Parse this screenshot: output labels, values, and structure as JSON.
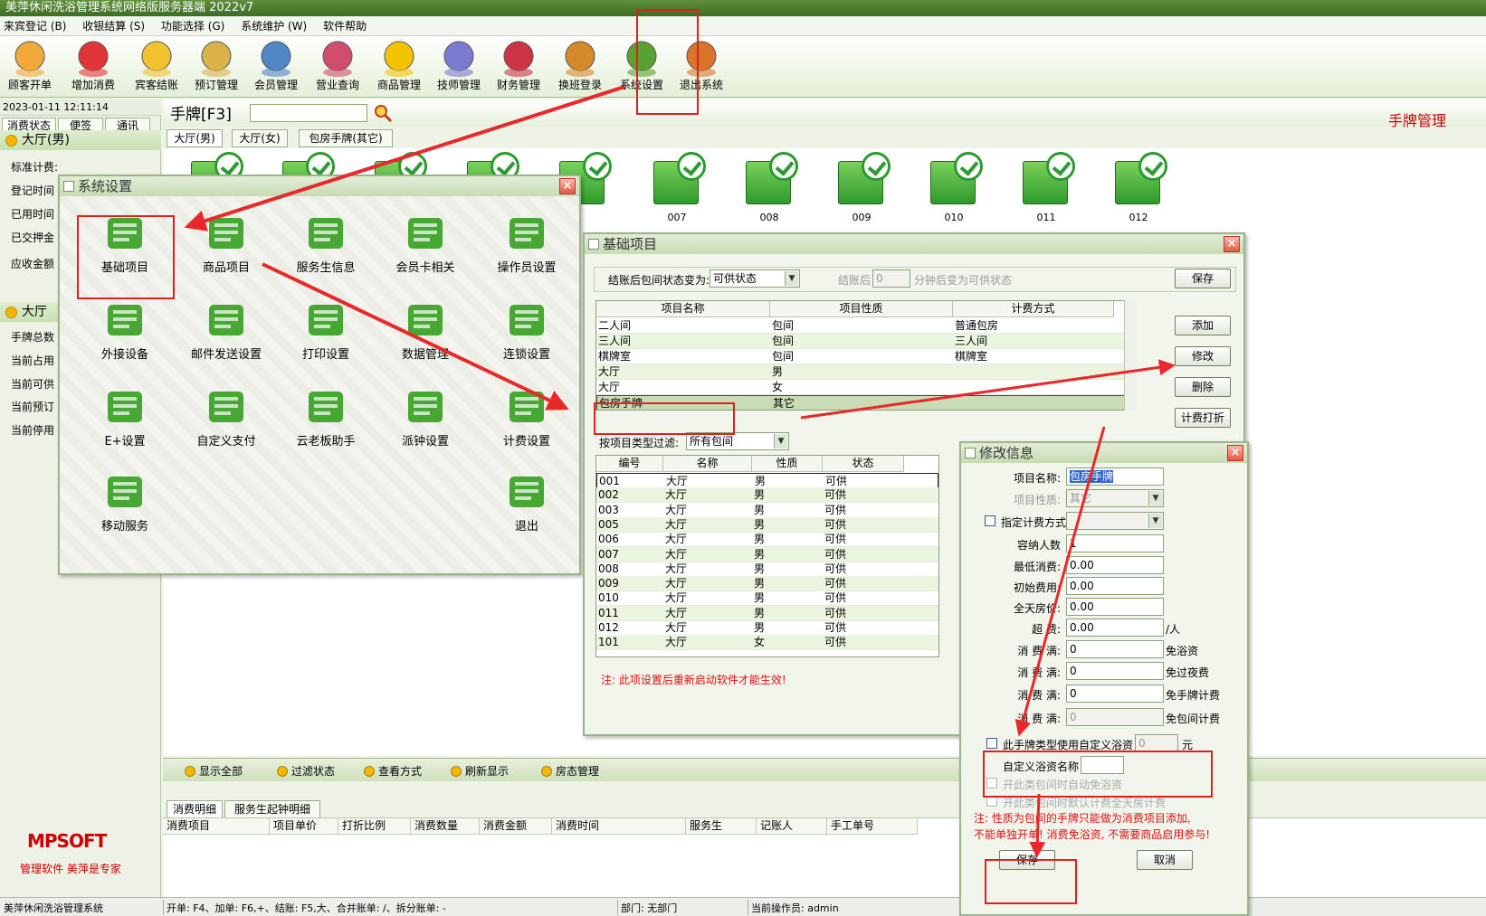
{
  "app": {
    "title": "美萍休闲洗浴管理系统网络版服务器端  2022v7"
  },
  "menu": [
    "来宾登记 (B)",
    "收银结算 (S)",
    "功能选择 (G)",
    "系统维护 (W)",
    "软件帮助"
  ],
  "toolbar": [
    {
      "label": "顾客开单",
      "icon": "customer-icon",
      "color": "#f2a93b"
    },
    {
      "label": "增加消费",
      "icon": "add-consume-icon",
      "color": "#e2353a"
    },
    {
      "label": "宾客结账",
      "icon": "checkout-icon",
      "color": "#f2c230"
    },
    {
      "label": "预订管理",
      "icon": "clock-icon",
      "color": "#d9b24a"
    },
    {
      "label": "会员管理",
      "icon": "members-icon",
      "color": "#4f86c6"
    },
    {
      "label": "营业查询",
      "icon": "query-icon",
      "color": "#d14d6e"
    },
    {
      "label": "商品管理",
      "icon": "star-icon",
      "color": "#f5c400"
    },
    {
      "label": "技师管理",
      "icon": "staff-icon",
      "color": "#7a7ad1"
    },
    {
      "label": "财务管理",
      "icon": "finance-icon",
      "color": "#cc3344"
    },
    {
      "label": "换班登录",
      "icon": "shift-icon",
      "color": "#d48a2a"
    },
    {
      "label": "系统设置",
      "icon": "gear-icon",
      "color": "#5aa032"
    },
    {
      "label": "退出系统",
      "icon": "exit-door-icon",
      "color": "#d9742a"
    }
  ],
  "left": {
    "datetime": "2023-01-11  12:11:14",
    "tabs": [
      "消费状态",
      "便签",
      "通讯"
    ],
    "section1": "大厅(男)",
    "rows1": [
      "标准计费:",
      "登记时间",
      "已用时间",
      "已交押金",
      "应收金额"
    ],
    "section2": "大厅",
    "rows2": [
      "手牌总数",
      "当前占用",
      "当前可供",
      "当前预订",
      "当前停用"
    ],
    "logo": "MPSOFT",
    "slogan": "管理软件   美萍是专家"
  },
  "main": {
    "title": "手牌[F3]",
    "right_title": "手牌管理",
    "tabs": [
      "大厅(男)",
      "大厅(女)",
      "包房手牌(其它)"
    ],
    "cards": [
      "",
      "",
      "",
      "",
      "",
      "007",
      "008",
      "009",
      "010",
      "011",
      "012"
    ]
  },
  "bottom": {
    "items": [
      "显示全部",
      "过滤状态",
      "查看方式",
      "刷新显示",
      "房态管理"
    ],
    "subtabs": [
      "消费明细",
      "服务生起钟明细"
    ],
    "columns": [
      "消费项目",
      "项目单价",
      "打折比例",
      "消费数量",
      "消费金额",
      "消费时间",
      "服务生",
      "记账人",
      "手工单号"
    ]
  },
  "statusbar": {
    "app": "美萍休闲洗浴管理系统",
    "keys": "开单: F4、加单: F6,+、结账: F5,大、合并账单: /、拆分账单: -",
    "dept": "部门: 无部门",
    "operator": "当前操作员: admin"
  },
  "sysset": {
    "title": "系统设置",
    "icons": [
      {
        "label": "基础项目",
        "icon": "star-icon"
      },
      {
        "label": "商品项目",
        "icon": "list-icon"
      },
      {
        "label": "服务生信息",
        "icon": "id-card-icon"
      },
      {
        "label": "会员卡相关",
        "icon": "briefcase-icon"
      },
      {
        "label": "操作员设置",
        "icon": "user-icon"
      },
      {
        "label": "外接设备",
        "icon": "bar-chart-icon"
      },
      {
        "label": "邮件发送设置",
        "icon": "mail-icon"
      },
      {
        "label": "打印设置",
        "icon": "server-icon"
      },
      {
        "label": "数据管理",
        "icon": "data-icon"
      },
      {
        "label": "连锁设置",
        "icon": "link-icon"
      },
      {
        "label": "E+设置",
        "icon": "cash-icon"
      },
      {
        "label": "自定义支付",
        "icon": "pay-icon"
      },
      {
        "label": "云老板助手",
        "icon": "cloud-icon"
      },
      {
        "label": "派钟设置",
        "icon": "pencil-icon"
      },
      {
        "label": "计费设置",
        "icon": "calculator-icon"
      },
      {
        "label": "移动服务",
        "icon": "money-stack-icon"
      },
      {
        "label": "退出",
        "icon": "power-icon"
      }
    ]
  },
  "basic": {
    "title": "基础项目",
    "status_label": "结账后包间状态变为:",
    "status_value": "可供状态",
    "after_label": "结账后",
    "after_value": "0",
    "after_suffix": "分钟后变为可供状态",
    "save": "保存",
    "columns": [
      "项目名称",
      "项目性质",
      "计费方式"
    ],
    "rows": [
      [
        "二人间",
        "包间",
        "普通包房"
      ],
      [
        "三人间",
        "包间",
        "三人间"
      ],
      [
        "棋牌室",
        "包间",
        "棋牌室"
      ],
      [
        "大厅",
        "男",
        ""
      ],
      [
        "大厅",
        "女",
        ""
      ],
      [
        "包房手牌",
        "其它",
        ""
      ]
    ],
    "buttons": [
      "添加",
      "修改",
      "删除",
      "计费打折"
    ],
    "filter_label": "按项目类型过滤:",
    "filter_value": "所有包间",
    "cols2": [
      "编号",
      "名称",
      "性质",
      "状态"
    ],
    "rows2": [
      [
        "001",
        "大厅",
        "男",
        "可供"
      ],
      [
        "002",
        "大厅",
        "男",
        "可供"
      ],
      [
        "003",
        "大厅",
        "男",
        "可供"
      ],
      [
        "005",
        "大厅",
        "男",
        "可供"
      ],
      [
        "006",
        "大厅",
        "男",
        "可供"
      ],
      [
        "007",
        "大厅",
        "男",
        "可供"
      ],
      [
        "008",
        "大厅",
        "男",
        "可供"
      ],
      [
        "009",
        "大厅",
        "男",
        "可供"
      ],
      [
        "010",
        "大厅",
        "男",
        "可供"
      ],
      [
        "011",
        "大厅",
        "男",
        "可供"
      ],
      [
        "012",
        "大厅",
        "男",
        "可供"
      ],
      [
        "101",
        "大厅",
        "女",
        "可供"
      ]
    ],
    "note": "注: 此项设置后重新启动软件才能生效!"
  },
  "modinfo": {
    "title": "修改信息",
    "name_label": "项目名称:",
    "name_value": "包房手牌",
    "type_label": "项目性质:",
    "type_value": "其它",
    "billing_label": "指定计费方式",
    "capacity_label": "容纳人数",
    "capacity_value": "1",
    "min_label": "最低消费:",
    "min_value": "0.00",
    "start_label": "初始费用:",
    "start_value": "0.00",
    "day_label": "全天房价:",
    "day_value": "0.00",
    "over_label": "超    费:",
    "over_value": "0.00",
    "over_unit": "/人",
    "f1_label": "消   费 满:",
    "f1_value": "0",
    "f1_unit": "免浴资",
    "f2_label": "消 费 满:",
    "f2_value": "0",
    "f2_unit": "免过夜费",
    "f3_label": "消 费 满:",
    "f3_value": "0",
    "f3_unit": "免手牌计费",
    "f4_label": "消 费 满:",
    "f4_value": "0",
    "f4_unit": "免包间计费",
    "custom_label": "此手牌类型使用自定义浴资",
    "custom_value": "0",
    "custom_unit": "元",
    "custom_name_label": "自定义浴资名称",
    "opt1": "开此类包间时自动免浴资",
    "opt2": "开此类包间时默认计费全天房计费",
    "note1": "注: 性质为包间的手牌只能做为消费项目添加,",
    "note2": "不能单独开单! 消费免浴资, 不需要商品启用参与!",
    "save": "保存",
    "cancel": "取消"
  }
}
